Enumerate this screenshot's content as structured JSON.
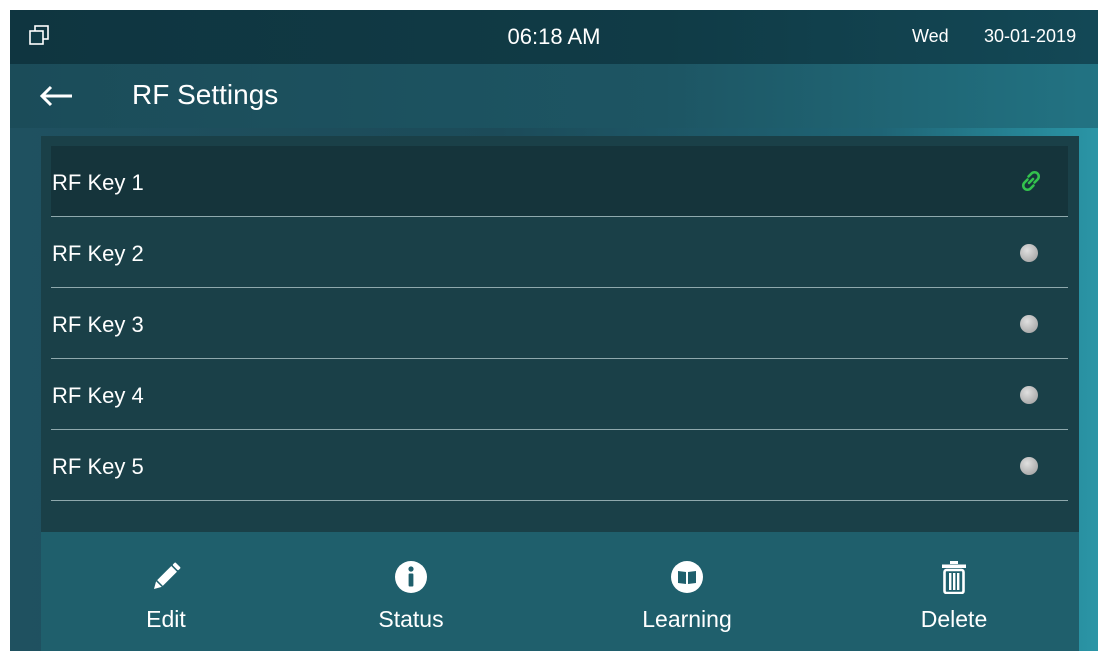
{
  "status_bar": {
    "time": "06:18 AM",
    "day": "Wed",
    "date": "30-01-2019",
    "left_icon": "multi-window-icon"
  },
  "header": {
    "back_icon": "back-arrow-icon",
    "title": "RF Settings"
  },
  "rf_keys": [
    {
      "label": "RF Key 1",
      "status": "linked",
      "icon": "link-icon",
      "selected": true
    },
    {
      "label": "RF Key 2",
      "status": "unlinked",
      "icon": "status-dot-icon",
      "selected": false
    },
    {
      "label": "RF Key 3",
      "status": "unlinked",
      "icon": "status-dot-icon",
      "selected": false
    },
    {
      "label": "RF Key 4",
      "status": "unlinked",
      "icon": "status-dot-icon",
      "selected": false
    },
    {
      "label": "RF Key 5",
      "status": "unlinked",
      "icon": "status-dot-icon",
      "selected": false
    }
  ],
  "toolbar": {
    "edit": {
      "label": "Edit",
      "icon": "pencil-icon"
    },
    "status": {
      "label": "Status",
      "icon": "info-icon"
    },
    "learning": {
      "label": "Learning",
      "icon": "book-icon"
    },
    "delete": {
      "label": "Delete",
      "icon": "trash-icon"
    }
  },
  "colors": {
    "link_green": "#33c24d",
    "inactive_dot": "#b9b9b9",
    "panel_bg": "#1a4048",
    "toolbar_bg": "#1f5f6c"
  }
}
